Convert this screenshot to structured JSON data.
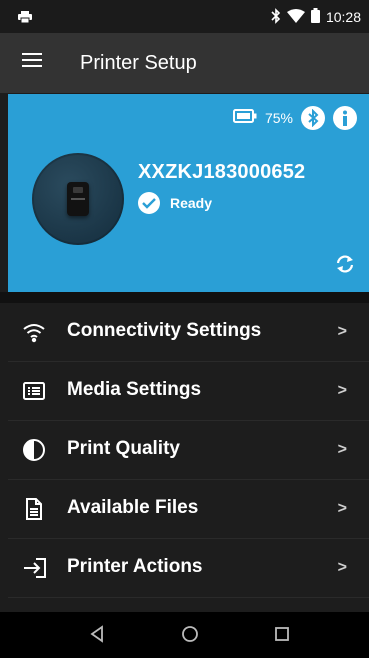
{
  "status_bar": {
    "time": "10:28"
  },
  "app_bar": {
    "title": "Printer Setup"
  },
  "printer": {
    "battery_percent": "75%",
    "serial": "XXZKJ183000652",
    "status": "Ready"
  },
  "menu": {
    "items": [
      {
        "label": "Connectivity Settings",
        "icon": "wifi-icon"
      },
      {
        "label": "Media Settings",
        "icon": "media-list-icon"
      },
      {
        "label": "Print Quality",
        "icon": "contrast-icon"
      },
      {
        "label": "Available Files",
        "icon": "file-icon"
      },
      {
        "label": "Printer Actions",
        "icon": "login-arrow-icon"
      }
    ],
    "chevron": ">"
  },
  "colors": {
    "accent": "#2a9fd6",
    "background": "#1d1d1d",
    "app_bar": "#333333"
  }
}
